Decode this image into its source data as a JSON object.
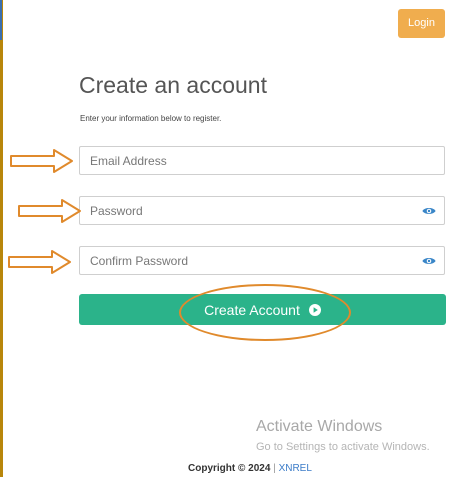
{
  "header": {
    "login_label": "Login"
  },
  "form": {
    "title": "Create an account",
    "subtitle": "Enter your information below to register.",
    "email_placeholder": "Email Address",
    "password_placeholder": "Password",
    "confirm_placeholder": "Confirm Password",
    "submit_label": "Create Account"
  },
  "overlay": {
    "activate_title": "Activate Windows",
    "activate_subtitle": "Go to Settings to activate Windows."
  },
  "footer": {
    "copyright": "Copyright © 2024",
    "separator": "|",
    "brand": "XNREL"
  },
  "colors": {
    "accent_green": "#2bb38a",
    "login_orange": "#f0ad4e",
    "annotation_orange": "#e08a2c",
    "eye_blue": "#3a86c8"
  },
  "icons": {
    "password_toggle": "eye-icon",
    "submit": "play-circle-icon",
    "annotations": [
      "arrow-right-icon",
      "highlight-oval"
    ]
  }
}
